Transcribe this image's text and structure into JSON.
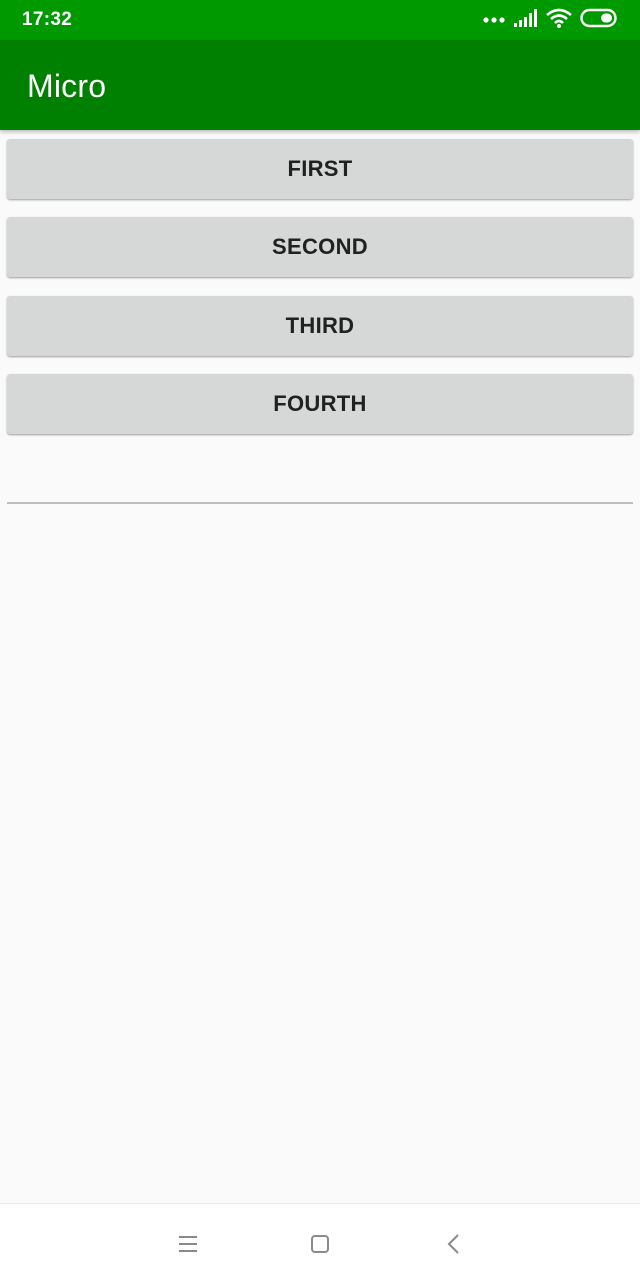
{
  "status_bar": {
    "time": "17:32",
    "icons": [
      "more-dots-icon",
      "signal-icon",
      "wifi-icon",
      "battery-icon"
    ]
  },
  "app_bar": {
    "title": "Micro",
    "color": "#008000",
    "status_color": "#009900"
  },
  "buttons": [
    {
      "label": "FIRST"
    },
    {
      "label": "SECOND"
    },
    {
      "label": "THIRD"
    },
    {
      "label": "FOURTH"
    }
  ],
  "text_field": {
    "value": "",
    "placeholder": ""
  },
  "nav_bar": {
    "icons": [
      "menu-icon",
      "home-icon",
      "back-icon"
    ]
  }
}
